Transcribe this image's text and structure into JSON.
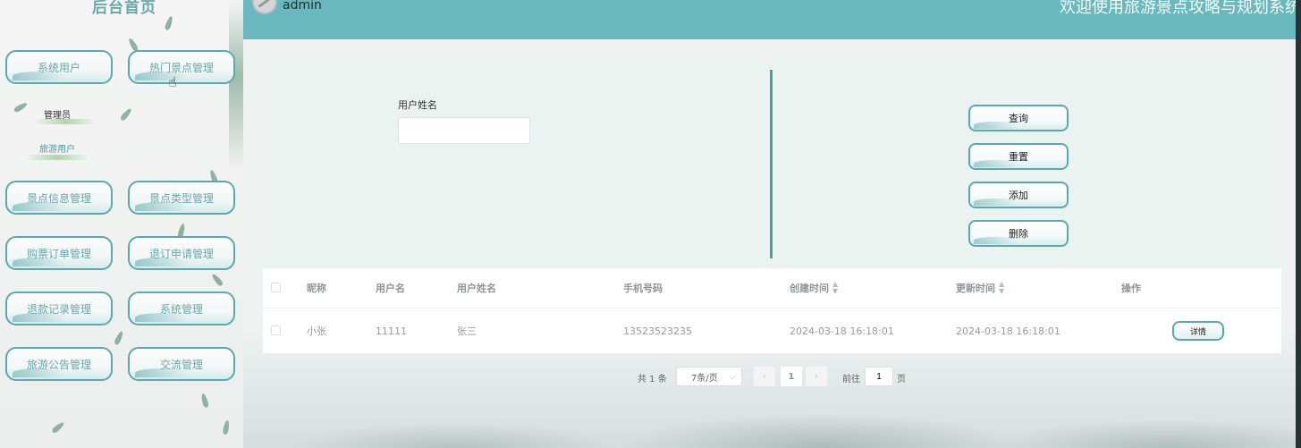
{
  "sidebar": {
    "title": "后台首页",
    "menu": [
      {
        "label": "系统用户",
        "name": "menu-system-users"
      },
      {
        "label": "热门景点管理",
        "name": "menu-hot-spots"
      },
      {
        "label": "景点信息管理",
        "name": "menu-spot-info"
      },
      {
        "label": "景点类型管理",
        "name": "menu-spot-types"
      },
      {
        "label": "购票订单管理",
        "name": "menu-ticket-orders"
      },
      {
        "label": "退订申请管理",
        "name": "menu-cancel-requests"
      },
      {
        "label": "退款记录管理",
        "name": "menu-refund-records"
      },
      {
        "label": "系统管理",
        "name": "menu-system-admin"
      },
      {
        "label": "旅游公告管理",
        "name": "menu-announcements"
      },
      {
        "label": "交流管理",
        "name": "menu-communication"
      }
    ],
    "submenu": [
      "管理员",
      "旅游用户"
    ]
  },
  "header": {
    "username": "admin",
    "welcome": "欢迎使用旅游景点攻略与规划系统"
  },
  "search": {
    "label": "用户姓名",
    "value": "",
    "placeholder": ""
  },
  "actions": {
    "query": "查询",
    "reset": "重置",
    "add": "添加",
    "delete": "删除"
  },
  "table": {
    "columns": [
      "昵称",
      "用户名",
      "用户姓名",
      "手机号码",
      "创建时间",
      "更新时间",
      "操作"
    ],
    "rows": [
      {
        "nickname": "小张",
        "username": "11111",
        "realname": "张三",
        "phone": "13523523235",
        "created": "2024-03-18 16:18:01",
        "updated": "2024-03-18 16:18:01",
        "action": "详情"
      }
    ]
  },
  "pagination": {
    "total": "共 1 条",
    "page_size": "7条/页",
    "current_page": "1",
    "goto_label": "前往",
    "goto_value": "1",
    "page_unit": "页"
  },
  "colors": {
    "accent": "#5aa9ad",
    "header": "#69b8bd",
    "panel": "#eaf3f0"
  }
}
